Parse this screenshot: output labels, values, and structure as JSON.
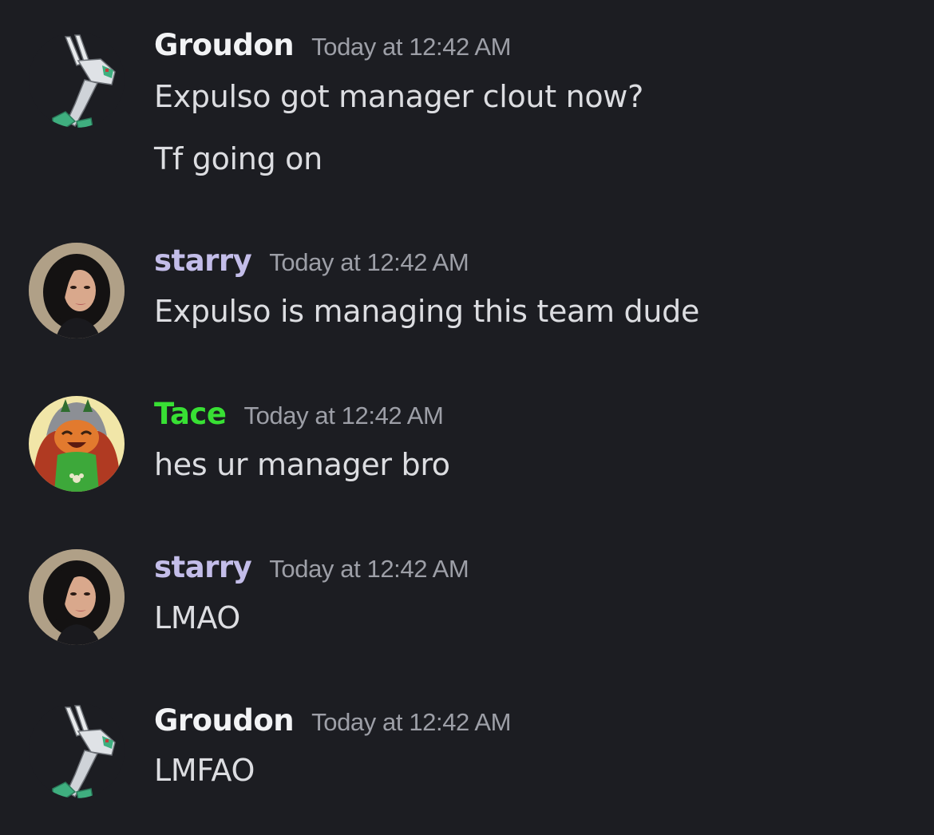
{
  "colors": {
    "background": "#1c1d22",
    "message_text": "#dcdde1",
    "timestamp": "#9d9fa7",
    "groudon_name": "#f2f3f5",
    "starry_name": "#c3bde9",
    "tace_name": "#38e034"
  },
  "messages": [
    {
      "username": "Groudon",
      "timestamp": "Today at 12:42 AM",
      "avatar_icon": "white-green-pixel-creature-icon",
      "lines": [
        "Expulso got manager clout now?",
        "Tf going on"
      ]
    },
    {
      "username": "starry",
      "timestamp": "Today at 12:42 AM",
      "avatar_icon": "dark-haired-woman-photo-avatar",
      "lines": [
        "Expulso is managing this team dude"
      ]
    },
    {
      "username": "Tace",
      "timestamp": "Today at 12:42 AM",
      "avatar_icon": "green-orange-cartoon-character-avatar",
      "lines": [
        "hes ur manager bro"
      ]
    },
    {
      "username": "starry",
      "timestamp": "Today at 12:42 AM",
      "avatar_icon": "dark-haired-woman-photo-avatar",
      "lines": [
        "LMAO"
      ]
    },
    {
      "username": "Groudon",
      "timestamp": "Today at 12:42 AM",
      "avatar_icon": "white-green-pixel-creature-icon",
      "lines": [
        "LMFAO"
      ]
    }
  ]
}
